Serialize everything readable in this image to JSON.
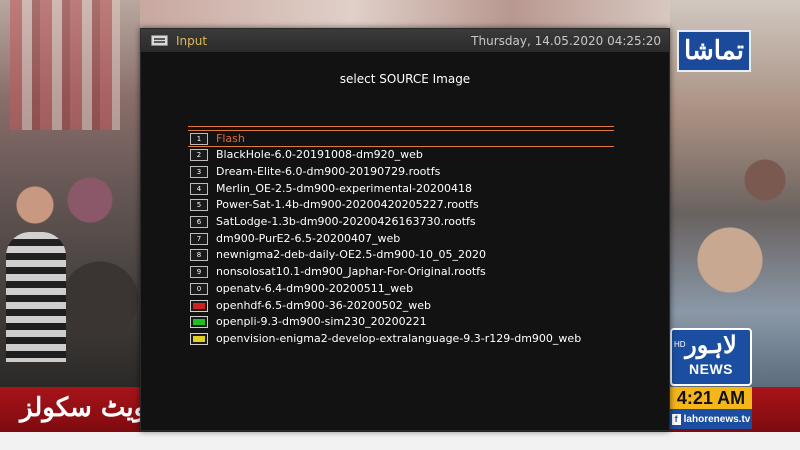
{
  "dialog": {
    "title": "Input",
    "datetime": "Thursday, 14.05.2020  04:25:20",
    "prompt": "select SOURCE Image"
  },
  "items": [
    {
      "key": "1",
      "label": "Flash",
      "selected": true
    },
    {
      "key": "2",
      "label": "BlackHole-6.0-20191008-dm920_web"
    },
    {
      "key": "3",
      "label": "Dream-Elite-6.0-dm900-20190729.rootfs"
    },
    {
      "key": "4",
      "label": "Merlin_OE-2.5-dm900-experimental-20200418"
    },
    {
      "key": "5",
      "label": "Power-Sat-1.4b-dm900-20200420205227.rootfs"
    },
    {
      "key": "6",
      "label": "SatLodge-1.3b-dm900-20200426163730.rootfs"
    },
    {
      "key": "7",
      "label": "dm900-PurE2-6.5-20200407_web"
    },
    {
      "key": "8",
      "label": "newnigma2-deb-daily-OE2.5-dm900-10_05_2020"
    },
    {
      "key": "9",
      "label": "nonsolosat10.1-dm900_Japhar-For-Original.rootfs"
    },
    {
      "key": "0",
      "label": "openatv-6.4-dm900-20200511_web"
    },
    {
      "key": "red",
      "label": "openhdf-6.5-dm900-36-20200502_web",
      "color": "#d02020"
    },
    {
      "key": "green",
      "label": "openpli-9.3-dm900-sim230_20200221",
      "color": "#20c020"
    },
    {
      "key": "yellow",
      "label": "openvision-enigma2-develop-extralanguage-9.3-r129-dm900_web",
      "color": "#e0d020"
    }
  ],
  "broadcast": {
    "channel_logo": "تماشا",
    "news_logo_urdu": "لاہور",
    "news_logo_hd": "HD",
    "news_logo_word": "NEWS",
    "clock": "4:21 AM",
    "website": "lahorenews.tv",
    "ticker": "ویٹ سکولز"
  },
  "colors": {
    "accent": "#e07a3c",
    "title": "#e0b85a",
    "dialog_bg": "#121212"
  }
}
